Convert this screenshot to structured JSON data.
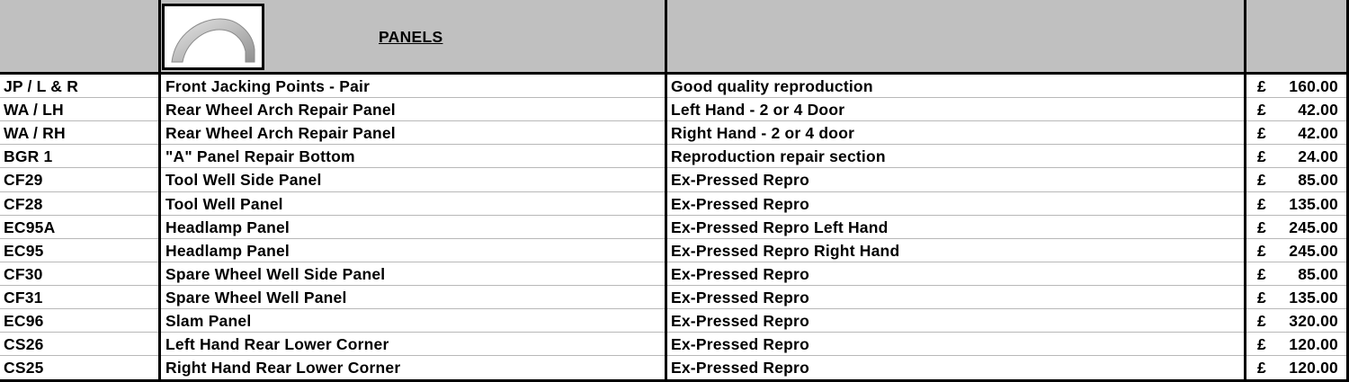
{
  "header": {
    "title": "PANELS",
    "thumbnail_icon": "wheel-arch-panel-icon"
  },
  "currency_symbol": "£",
  "rows": [
    {
      "code": "JP / L & R",
      "description": "Front Jacking Points - Pair",
      "note": "Good quality reproduction",
      "price": "160.00"
    },
    {
      "code": "WA / LH",
      "description": "Rear Wheel Arch Repair Panel",
      "note": "Left Hand - 2 or 4 Door",
      "price": "42.00"
    },
    {
      "code": "WA / RH",
      "description": "Rear Wheel Arch Repair Panel",
      "note": "Right Hand - 2 or 4 door",
      "price": "42.00"
    },
    {
      "code": "BGR 1",
      "description": "\"A\" Panel Repair Bottom",
      "note": "Reproduction repair section",
      "price": "24.00"
    },
    {
      "code": "CF29",
      "description": "Tool Well Side Panel",
      "note": "Ex-Pressed Repro",
      "price": "85.00"
    },
    {
      "code": "CF28",
      "description": "Tool Well Panel",
      "note": "Ex-Pressed Repro",
      "price": "135.00"
    },
    {
      "code": "EC95A",
      "description": "Headlamp Panel",
      "note": "Ex-Pressed Repro Left Hand",
      "price": "245.00"
    },
    {
      "code": "EC95",
      "description": "Headlamp Panel",
      "note": "Ex-Pressed Repro Right Hand",
      "price": "245.00"
    },
    {
      "code": "CF30",
      "description": "Spare Wheel Well Side Panel",
      "note": "Ex-Pressed Repro",
      "price": "85.00"
    },
    {
      "code": "CF31",
      "description": "Spare Wheel Well Panel",
      "note": "Ex-Pressed Repro",
      "price": "135.00"
    },
    {
      "code": "EC96",
      "description": "Slam Panel",
      "note": "Ex-Pressed Repro",
      "price": "320.00"
    },
    {
      "code": "CS26",
      "description": "Left Hand Rear Lower Corner",
      "note": "Ex-Pressed Repro",
      "price": "120.00"
    },
    {
      "code": "CS25",
      "description": "Right Hand Rear Lower Corner",
      "note": "Ex-Pressed Repro",
      "price": "120.00"
    }
  ]
}
